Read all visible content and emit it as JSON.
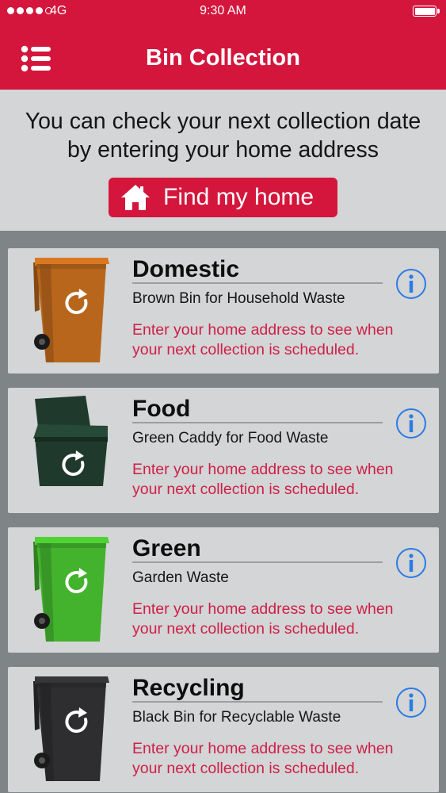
{
  "status_bar": {
    "carrier": "4G",
    "time": "9:30 AM",
    "signal_bars": 4,
    "signal_total": 5
  },
  "header": {
    "title": "Bin Collection",
    "menu_icon": "list-menu-icon",
    "background": "#d4163c"
  },
  "intro": {
    "text": "You can check your next collection date by entering your home address",
    "find_home_label": "Find my home",
    "find_home_icon": "house-icon"
  },
  "bins": [
    {
      "title": "Domestic",
      "subtitle": "Brown Bin for Household Waste",
      "message": "Enter your home address to see when your next collection is scheduled.",
      "bin_style": "wheelie",
      "bin_color": "#b8661c",
      "info_icon": "info-icon"
    },
    {
      "title": "Food",
      "subtitle": "Green Caddy for Food Waste",
      "message": "Enter your home address to see when your next collection is scheduled.",
      "bin_style": "caddy",
      "bin_color": "#1f3a2c",
      "info_icon": "info-icon"
    },
    {
      "title": "Green",
      "subtitle": "Garden Waste",
      "message": "Enter your home address to see when your next collection is scheduled.",
      "bin_style": "wheelie",
      "bin_color": "#43b22d",
      "info_icon": "info-icon"
    },
    {
      "title": "Recycling",
      "subtitle": "Black Bin for Recyclable Waste",
      "message": "Enter your home address to see when your next collection is scheduled.",
      "bin_style": "wheelie",
      "bin_color": "#2e2e30",
      "info_icon": "info-icon"
    }
  ]
}
